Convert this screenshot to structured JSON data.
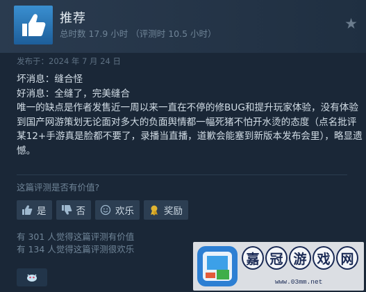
{
  "header": {
    "title": "推荐",
    "hours": "总时数 17.9 小时 （评测时 10.5 小时）"
  },
  "posted": "发布于：2024 年 7 月 24 日",
  "review": {
    "lines": [
      "坏消息：缝合怪",
      "好消息：全缝了，完美缝合",
      "唯一的缺点是作者发售近一周以来一直在不停的修BUG和提升玩家体验，没有体验到国产网游策划无论面对多大的负面舆情都一幅死猪不怕开水烫的态度（点名批评某12+手游真是脸都不要了，录播当直播，道歉会能塞到新版本发布会里），略显遗憾。"
    ]
  },
  "helpful_question": "这篇评测是否有价值?",
  "buttons": {
    "yes": "是",
    "no": "否",
    "funny": "欢乐",
    "award": "奖励"
  },
  "counts": {
    "helpful": "有 301 人觉得这篇评测有价值",
    "funny": "有 134 人觉得这篇评测很欢乐"
  },
  "watermark": {
    "chars": [
      "嘉",
      "冠",
      "游",
      "戏",
      "网"
    ],
    "url": "www.03mm.net"
  },
  "colors": {
    "accent_blue": "#3a8fd0",
    "background": "#1a2737",
    "award_gold": "#e0b431"
  }
}
